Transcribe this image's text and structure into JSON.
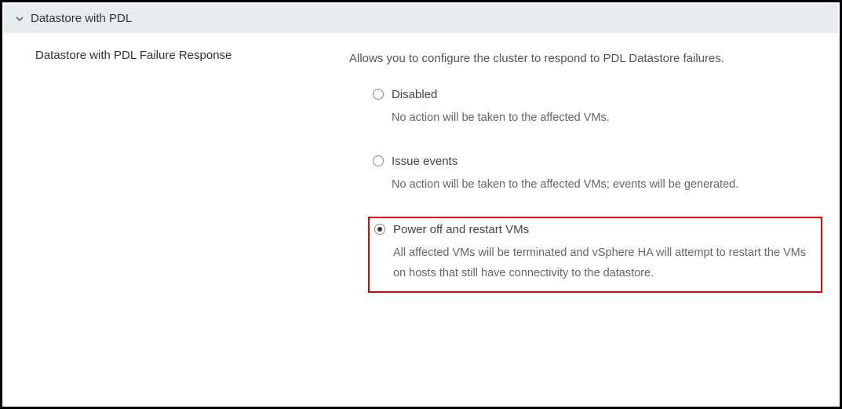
{
  "section": {
    "title": "Datastore with PDL"
  },
  "setting": {
    "label": "Datastore with PDL Failure Response",
    "description": "Allows you to configure the cluster to respond to PDL Datastore failures.",
    "options": [
      {
        "label": "Disabled",
        "description": "No action will be taken to the affected VMs.",
        "selected": false,
        "highlight": false
      },
      {
        "label": "Issue events",
        "description": "No action will be taken to the affected VMs; events will be generated.",
        "selected": false,
        "highlight": false
      },
      {
        "label": "Power off and restart VMs",
        "description": "All affected VMs will be terminated and vSphere HA will attempt to restart the VMs on hosts that still have connectivity to the datastore.",
        "selected": true,
        "highlight": true
      }
    ]
  }
}
